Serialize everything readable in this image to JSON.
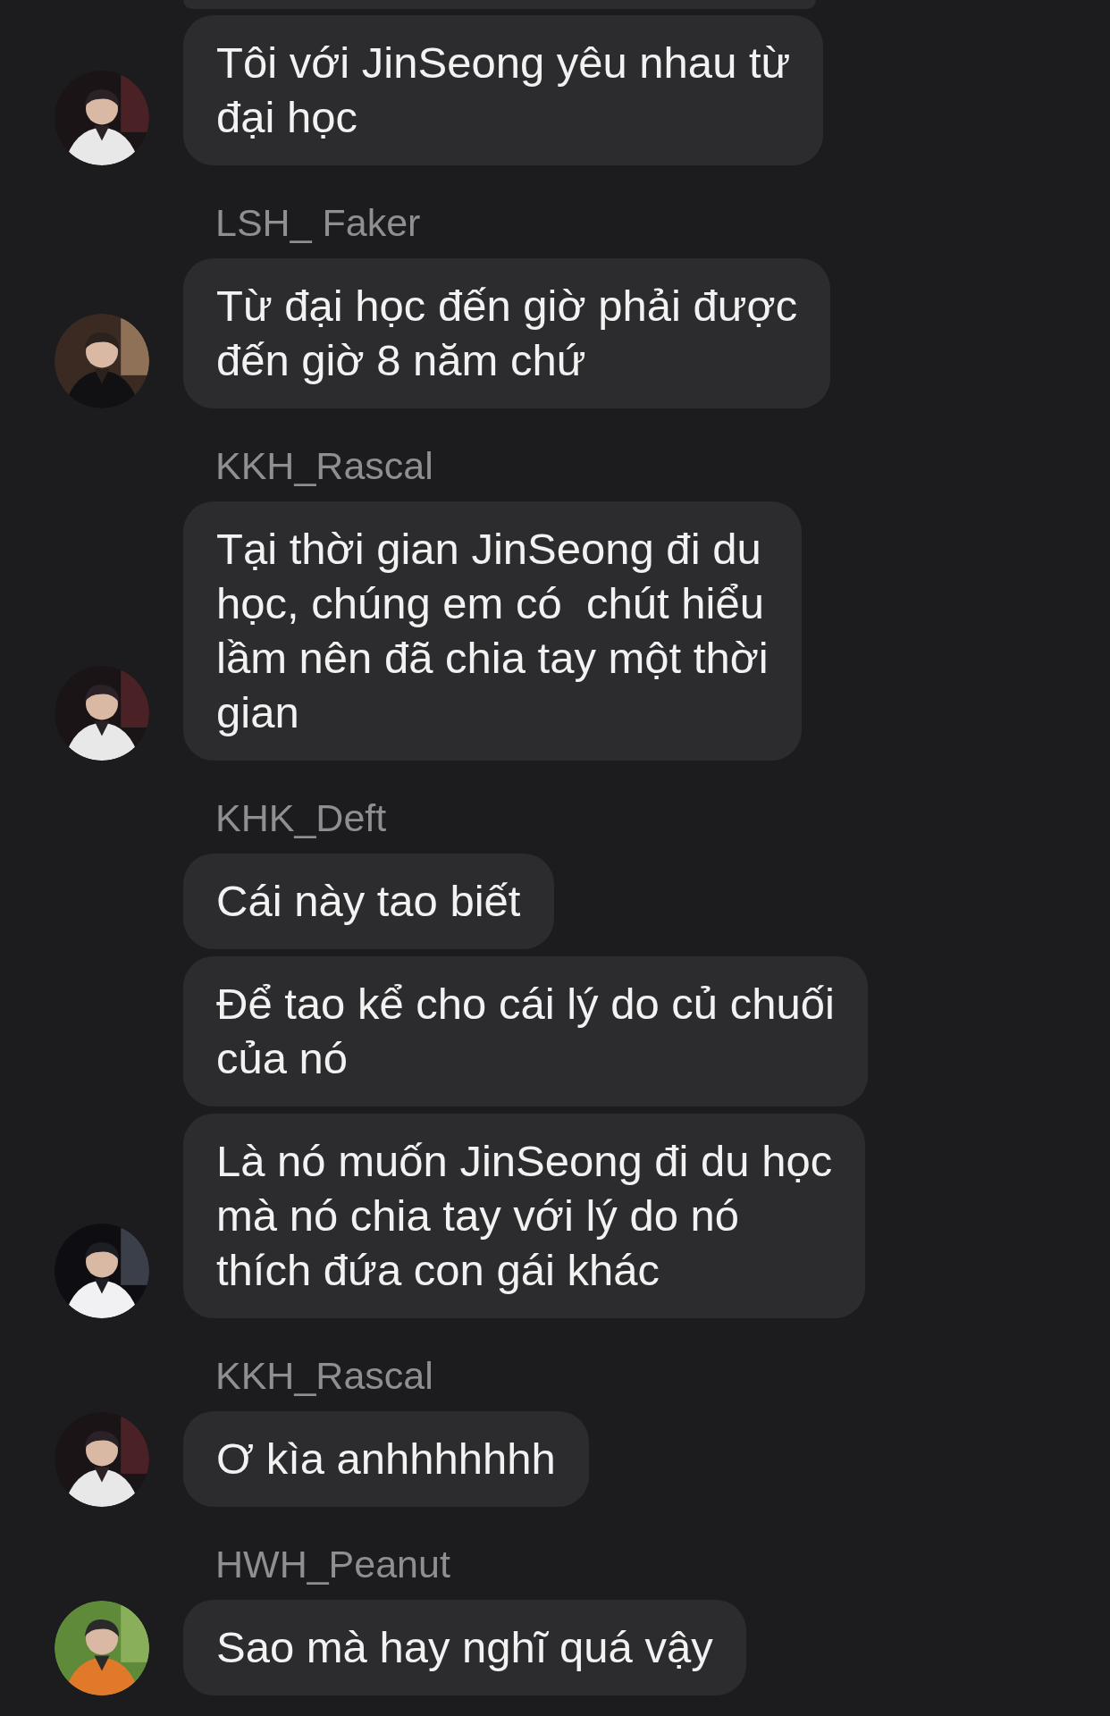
{
  "groups": [
    {
      "messages": [
        "Tôi với JinSeong yêu nhau từ\nđại học"
      ]
    },
    {
      "sender": "LSH_ Faker",
      "messages": [
        "Từ đại học đến giờ phải được\nđến giờ 8 năm chứ"
      ]
    },
    {
      "sender": "KKH_Rascal",
      "messages": [
        "Tại thời gian JinSeong đi du\nhọc, chúng em có  chút hiểu\nlầm nên đã chia tay một thời\ngian"
      ]
    },
    {
      "sender": "KHK_Deft",
      "messages": [
        "Cái này tao biết",
        "Để tao kể cho cái lý do củ chuối\ncủa nó",
        "Là nó muốn JinSeong đi du học\nmà nó chia tay với lý do nó\nthích đứa con gái khác"
      ]
    },
    {
      "sender": "KKH_Rascal",
      "messages": [
        "Ơ kìa anhhhhhhh"
      ]
    },
    {
      "sender": "HWH_Peanut",
      "messages": [
        "Sao mà hay nghĩ quá vậy"
      ]
    }
  ]
}
